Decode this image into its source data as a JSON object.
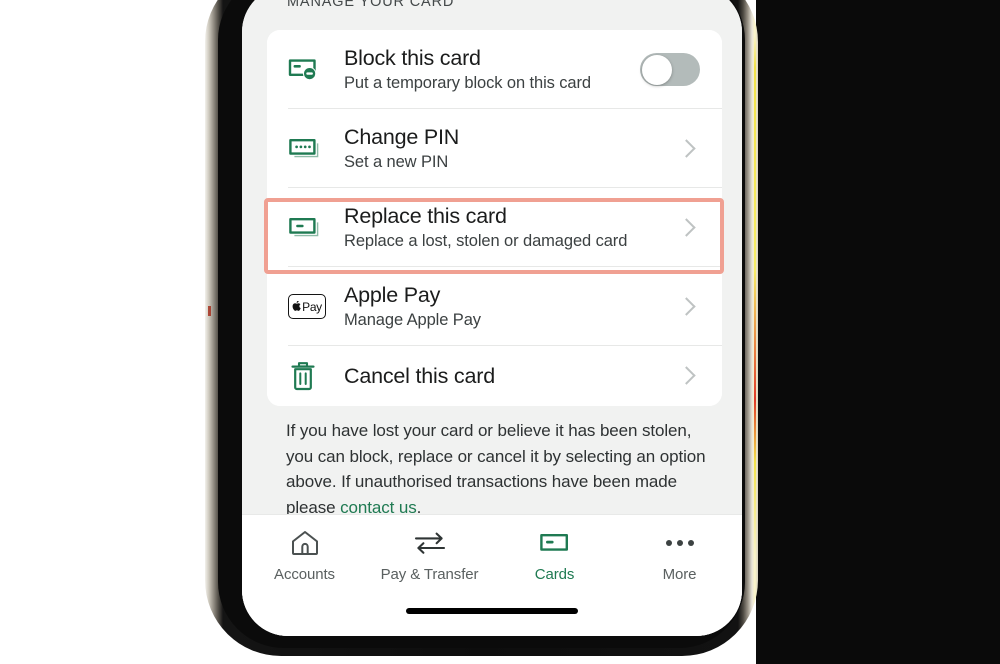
{
  "section": {
    "header": "MANAGE YOUR CARD"
  },
  "colors": {
    "brand_green": "#1f7a52",
    "highlight_border": "#f0a092",
    "page_bg": "#f1f2f1",
    "card_bg": "#ffffff",
    "toggle_off_track": "#b3bbba",
    "chevron": "#bfc3c3"
  },
  "rows": [
    {
      "id": "block-this-card",
      "icon": "card-block-icon",
      "title": "Block this card",
      "subtitle": "Put a temporary block on this card",
      "control": "toggle",
      "toggle_state": "off",
      "highlighted": false
    },
    {
      "id": "change-pin",
      "icon": "card-pin-icon",
      "title": "Change PIN",
      "subtitle": "Set a new PIN",
      "control": "chevron",
      "highlighted": false
    },
    {
      "id": "replace-this-card",
      "icon": "card-replace-icon",
      "title": "Replace this card",
      "subtitle": "Replace a lost, stolen or damaged card",
      "control": "chevron",
      "highlighted": true
    },
    {
      "id": "apple-pay",
      "icon": "apple-pay-icon",
      "title": "Apple Pay",
      "subtitle": "Manage Apple Pay",
      "control": "chevron",
      "highlighted": false
    },
    {
      "id": "cancel-this-card",
      "icon": "trash-icon",
      "title": "Cancel this card",
      "subtitle": "",
      "control": "chevron",
      "highlighted": false
    }
  ],
  "footer": {
    "text_before_link": "If you have lost your card or believe it has been stolen, you can block, replace or cancel it by selecting an option above. If unauthorised transactions have been made please ",
    "link_text": "contact us",
    "text_after_link": "."
  },
  "tabbar": {
    "items": [
      {
        "id": "accounts",
        "icon": "home-icon",
        "label": "Accounts",
        "active": false
      },
      {
        "id": "pay-transfer",
        "icon": "transfer-arrows-icon",
        "label": "Pay & Transfer",
        "active": false
      },
      {
        "id": "cards",
        "icon": "card-icon",
        "label": "Cards",
        "active": true
      },
      {
        "id": "more",
        "icon": "ellipsis-icon",
        "label": "More",
        "active": false
      }
    ]
  },
  "apple_pay_badge": {
    "label": "Pay"
  }
}
